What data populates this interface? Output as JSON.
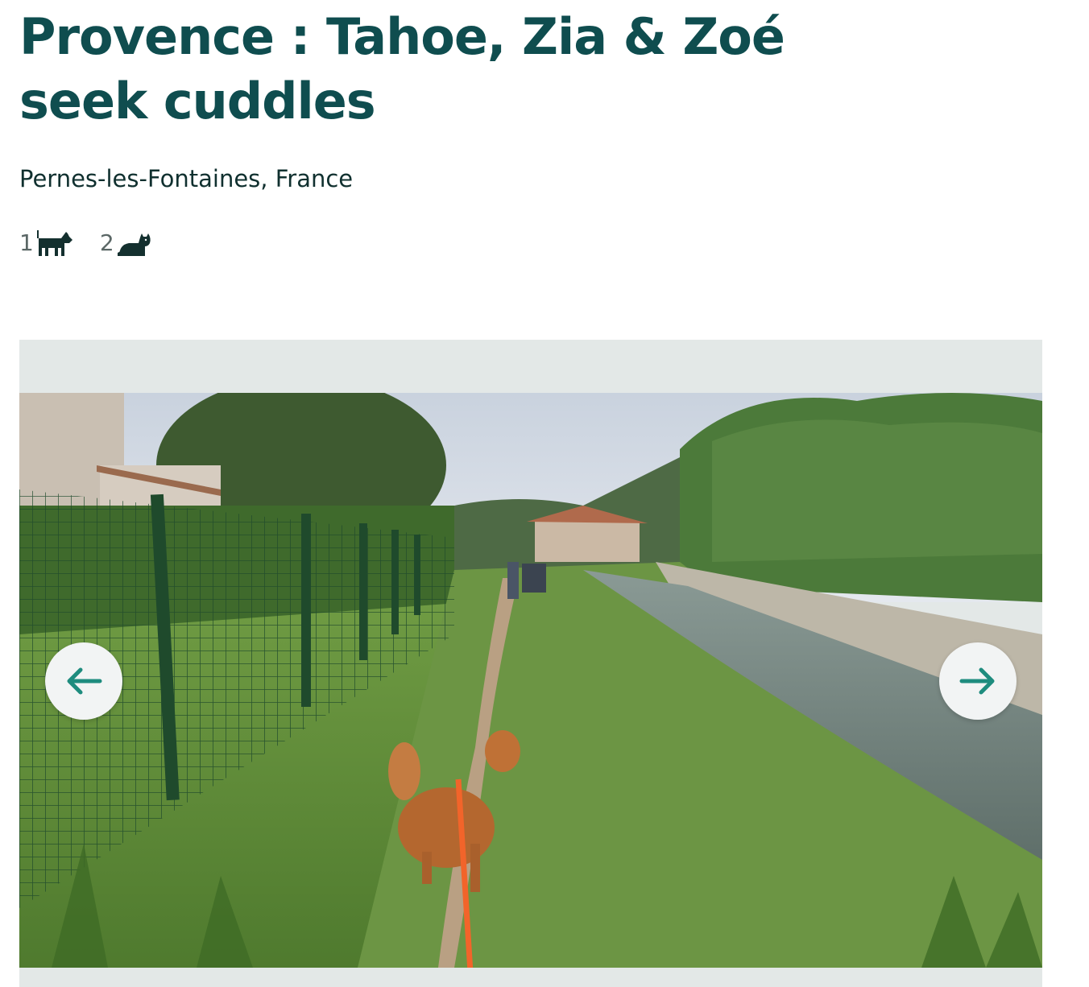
{
  "listing": {
    "title": "Provence : Tahoe, Zia & Zoé seek cuddles",
    "location": "Pernes-les-Fontaines, France",
    "pets": [
      {
        "count": "1",
        "icon": "dog-icon"
      },
      {
        "count": "2",
        "icon": "cat-icon"
      }
    ]
  },
  "gallery": {
    "prev_icon": "arrow-left-icon",
    "next_icon": "arrow-right-icon"
  },
  "colors": {
    "heading": "#0f4d4f",
    "accent": "#1e8c7e",
    "gallery_background": "#e3e8e7"
  }
}
